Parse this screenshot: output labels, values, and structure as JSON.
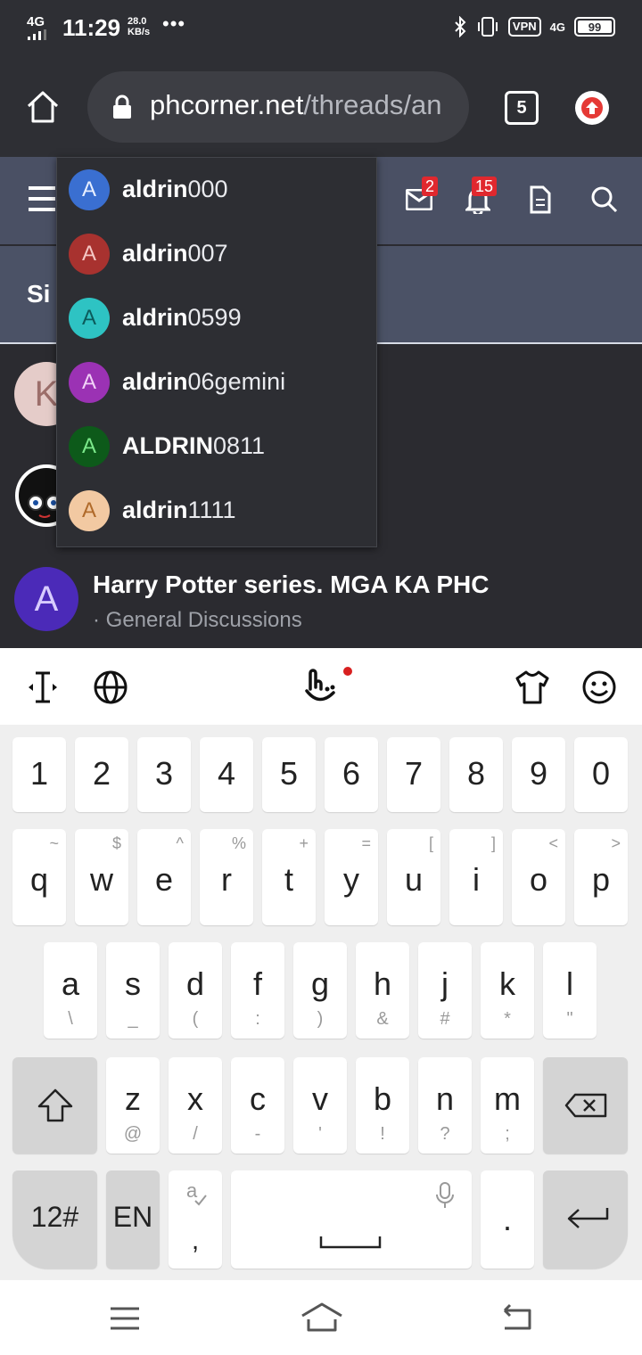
{
  "status_bar": {
    "network": "4G",
    "time": "11:29",
    "speed_value": "28.0",
    "speed_unit": "KB/s",
    "more": "•••",
    "vpn": "VPN",
    "net2": "4G",
    "battery": "99"
  },
  "browser": {
    "domain": "phcorner.net",
    "path": "/threads/an",
    "tab_count": "5"
  },
  "site_header": {
    "messages_badge": "2",
    "alerts_badge": "15"
  },
  "subheader": {
    "title_partial": "Si"
  },
  "mention_suggestions": [
    {
      "initial": "A",
      "prefix": "aldrin",
      "rest": "000",
      "color": "#3a6fd1",
      "letter_color": "#e8efff"
    },
    {
      "initial": "A",
      "prefix": "aldrin",
      "rest": "007",
      "color": "#a8322f",
      "letter_color": "#f4c7c4"
    },
    {
      "initial": "A",
      "prefix": "aldrin",
      "rest": "0599",
      "color": "#2ec3c3",
      "letter_color": "#0b5b5b"
    },
    {
      "initial": "A",
      "prefix": "aldrin",
      "rest": "06gemini",
      "color": "#9b32b4",
      "letter_color": "#f1d2f7"
    },
    {
      "initial": "A",
      "prefix": "ALDRIN",
      "rest": "0811",
      "color": "#0d5a1a",
      "letter_color": "#7be88a"
    },
    {
      "initial": "A",
      "prefix": "aldrin",
      "rest": "1111",
      "color": "#f2c9a2",
      "letter_color": "#b06a2a"
    }
  ],
  "threads": [
    {
      "initial": "K",
      "avatar_color": "#e5ccc9"
    },
    {
      "initial": "",
      "avatar_color": "#111111"
    },
    {
      "initial": "A",
      "avatar_color": "#4b2ab8",
      "title": "Harry Potter series. MGA KA PHC",
      "forum": "· General Discussions"
    }
  ],
  "keyboard": {
    "numbers": [
      "1",
      "2",
      "3",
      "4",
      "5",
      "6",
      "7",
      "8",
      "9",
      "0"
    ],
    "row1": [
      {
        "k": "q",
        "s": "~"
      },
      {
        "k": "w",
        "s": "$"
      },
      {
        "k": "e",
        "s": "^"
      },
      {
        "k": "r",
        "s": "%"
      },
      {
        "k": "t",
        "s": "+"
      },
      {
        "k": "y",
        "s": "="
      },
      {
        "k": "u",
        "s": "["
      },
      {
        "k": "i",
        "s": "]"
      },
      {
        "k": "o",
        "s": "<"
      },
      {
        "k": "p",
        "s": ">"
      }
    ],
    "row2": [
      {
        "k": "a",
        "s": "\\"
      },
      {
        "k": "s",
        "s": "_"
      },
      {
        "k": "d",
        "s": "("
      },
      {
        "k": "f",
        "s": ":"
      },
      {
        "k": "g",
        "s": ")"
      },
      {
        "k": "h",
        "s": "&"
      },
      {
        "k": "j",
        "s": "#"
      },
      {
        "k": "k",
        "s": "*"
      },
      {
        "k": "l",
        "s": "\""
      }
    ],
    "row3": [
      {
        "k": "z",
        "s": "@"
      },
      {
        "k": "x",
        "s": "/"
      },
      {
        "k": "c",
        "s": "-"
      },
      {
        "k": "v",
        "s": "'"
      },
      {
        "k": "b",
        "s": "!"
      },
      {
        "k": "n",
        "s": "?"
      },
      {
        "k": "m",
        "s": ";"
      }
    ],
    "sym_label": "12#",
    "lang_label": "EN",
    "comma_label": ",",
    "period_label": "."
  }
}
